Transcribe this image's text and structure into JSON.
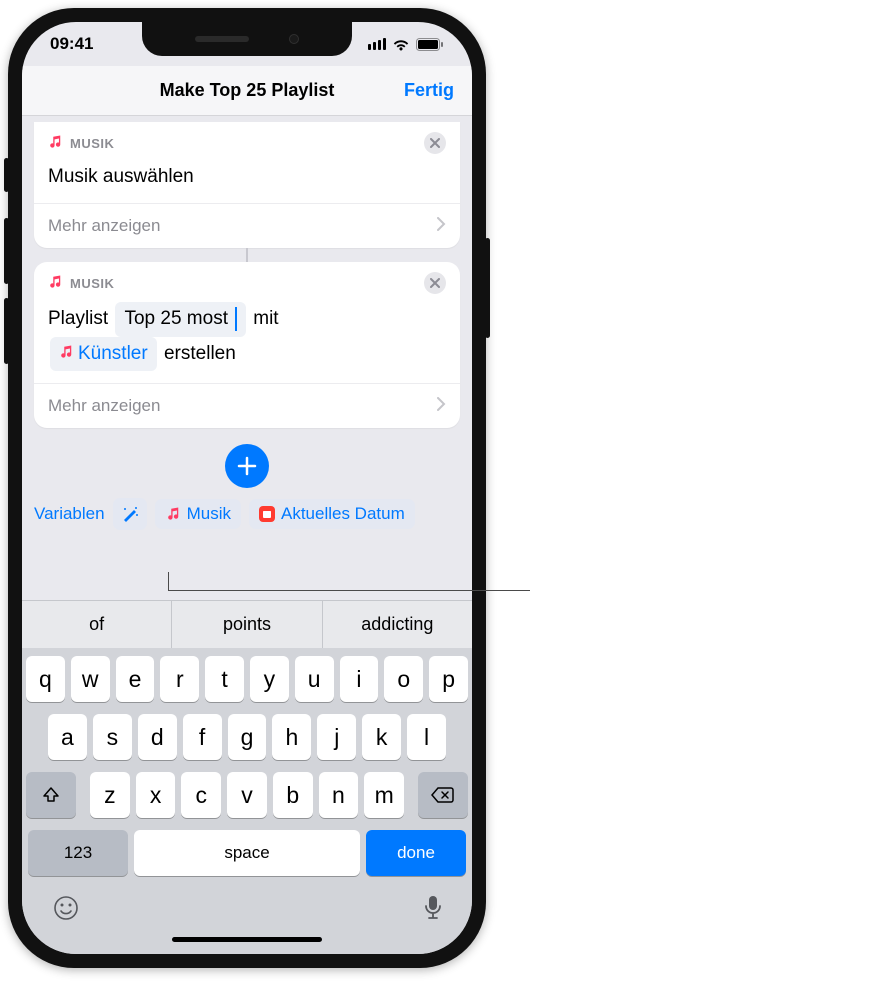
{
  "status": {
    "time": "09:41"
  },
  "nav": {
    "title": "Make Top 25 Playlist",
    "done": "Fertig"
  },
  "card1": {
    "app": "MUSIK",
    "title": "Musik auswählen",
    "more": "Mehr anzeigen"
  },
  "card2": {
    "app": "MUSIK",
    "prefix": "Playlist",
    "name_token": "Top 25 most",
    "mid": "mit",
    "var_token": "Künstler",
    "suffix": "erstellen",
    "more": "Mehr anzeigen"
  },
  "varbar": {
    "label": "Variablen",
    "music": "Musik",
    "date": "Aktuelles Datum"
  },
  "suggestions": {
    "s1": "of",
    "s2": "points",
    "s3": "addicting"
  },
  "keys": {
    "r1": [
      "q",
      "w",
      "e",
      "r",
      "t",
      "y",
      "u",
      "i",
      "o",
      "p"
    ],
    "r2": [
      "a",
      "s",
      "d",
      "f",
      "g",
      "h",
      "j",
      "k",
      "l"
    ],
    "r3": [
      "z",
      "x",
      "c",
      "v",
      "b",
      "n",
      "m"
    ],
    "numbers": "123",
    "space": "space",
    "done": "done"
  }
}
